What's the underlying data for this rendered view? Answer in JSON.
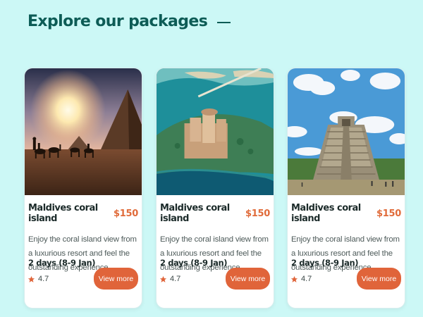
{
  "section": {
    "title": "Explore our packages"
  },
  "cards": [
    {
      "image": "desert-pyramid-camels",
      "title": "Maldives coral island",
      "price": "$150",
      "description": "Enjoy the coral island view from a luxurious resort and feel the outstanding experience",
      "duration": "2 days (8-9 Jan)",
      "rating": "4.7",
      "button_label": "View more"
    },
    {
      "image": "palm-island-resort-aerial",
      "title": "Maldives coral island",
      "price": "$150",
      "description": "Enjoy the coral island view from a luxurious resort and feel the outstanding experience",
      "duration": "2 days (8-9 Jan)",
      "rating": "4.7",
      "button_label": "View more"
    },
    {
      "image": "chichen-itza-pyramid",
      "title": "Maldives coral island",
      "price": "$150",
      "description": "Enjoy the coral island view from a luxurious resort and feel the outstanding experience",
      "duration": "2 days (8-9 Jan)",
      "rating": "4.7",
      "button_label": "View more"
    }
  ],
  "colors": {
    "background": "#ccf8f6",
    "heading": "#0d5c56",
    "accent": "#e0643a"
  },
  "icons": {
    "rating": "star-icon"
  }
}
